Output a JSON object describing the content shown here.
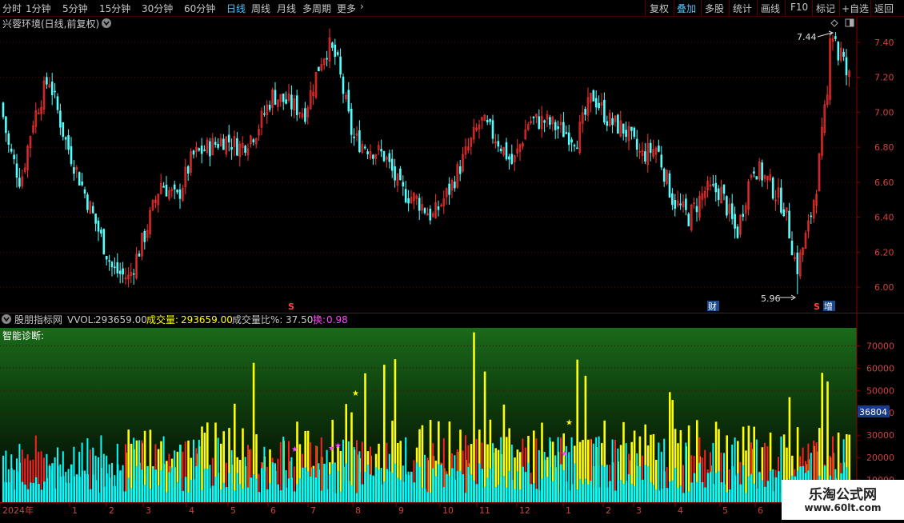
{
  "toolbar": {
    "periods": [
      "分时",
      "1分钟",
      "5分钟",
      "15分钟",
      "30分钟",
      "60分钟",
      "日线",
      "周线",
      "月线",
      "多周期",
      "更多"
    ],
    "active_period": "日线",
    "right_buttons": [
      "复权",
      "叠加",
      "多股",
      "统计",
      "画线",
      "F10",
      "标记",
      "+自选",
      "返回"
    ],
    "active_right": "叠加"
  },
  "main_chart": {
    "title": "兴蓉环境(日线,前复权)",
    "price_high_label": "7.44",
    "price_low_label": "5.96",
    "event_markers": [
      "财",
      "增"
    ],
    "s_markers": [
      "S",
      "S"
    ]
  },
  "indicator": {
    "name": "股朋指标网",
    "vol_label": "VVOL:",
    "vol_value": "293659.00",
    "cjl_label": "成交量:",
    "cjl_value": "293659.00",
    "ratio_label": "成交量比%:",
    "ratio_value": "37.50",
    "turnover_label": "换:",
    "turnover_value": "0.98",
    "diagnosis_label": "智能诊断:",
    "current_value_tag": "36804"
  },
  "time_axis": {
    "labels": [
      "2024年",
      "1",
      "2",
      "3",
      "4",
      "5",
      "6",
      "7",
      "8",
      "9",
      "10",
      "11",
      "12",
      "1",
      "2",
      "3",
      "4",
      "5",
      "6"
    ]
  },
  "watermark": {
    "line1": "乐淘公式网",
    "line2": "www.60lt.com"
  },
  "chart_data": [
    {
      "type": "candlestick",
      "title": "兴蓉环境(日线,前复权)",
      "y_ticks": [
        6.0,
        6.2,
        6.4,
        6.6,
        6.8,
        7.0,
        7.2,
        7.4
      ],
      "ylim": [
        5.9,
        7.5
      ],
      "high": 7.44,
      "low": 5.96,
      "close_path_anchors": [
        [
          0,
          7.05
        ],
        [
          10,
          6.8
        ],
        [
          25,
          6.6
        ],
        [
          40,
          6.95
        ],
        [
          60,
          7.2
        ],
        [
          80,
          6.85
        ],
        [
          100,
          6.6
        ],
        [
          120,
          6.35
        ],
        [
          140,
          6.1
        ],
        [
          160,
          6.05
        ],
        [
          180,
          6.3
        ],
        [
          200,
          6.6
        ],
        [
          220,
          6.5
        ],
        [
          240,
          6.75
        ],
        [
          260,
          6.8
        ],
        [
          280,
          6.85
        ],
        [
          300,
          6.8
        ],
        [
          320,
          6.9
        ],
        [
          340,
          7.1
        ],
        [
          360,
          7.05
        ],
        [
          380,
          7.0
        ],
        [
          400,
          7.3
        ],
        [
          410,
          7.38
        ],
        [
          420,
          7.3
        ],
        [
          440,
          6.85
        ],
        [
          460,
          6.8
        ],
        [
          480,
          6.75
        ],
        [
          500,
          6.55
        ],
        [
          520,
          6.5
        ],
        [
          540,
          6.4
        ],
        [
          560,
          6.55
        ],
        [
          580,
          6.75
        ],
        [
          600,
          6.95
        ],
        [
          620,
          6.85
        ],
        [
          640,
          6.7
        ],
        [
          660,
          6.95
        ],
        [
          680,
          6.95
        ],
        [
          700,
          6.9
        ],
        [
          720,
          6.85
        ],
        [
          740,
          7.1
        ],
        [
          760,
          6.95
        ],
        [
          780,
          6.9
        ],
        [
          800,
          6.75
        ],
        [
          820,
          6.8
        ],
        [
          840,
          6.5
        ],
        [
          860,
          6.4
        ],
        [
          880,
          6.55
        ],
        [
          900,
          6.55
        ],
        [
          920,
          6.3
        ],
        [
          940,
          6.7
        ],
        [
          960,
          6.6
        ],
        [
          980,
          6.45
        ],
        [
          995,
          6.1
        ],
        [
          1010,
          6.35
        ],
        [
          1020,
          6.6
        ],
        [
          1030,
          7.0
        ],
        [
          1040,
          7.25
        ],
        [
          1050,
          7.35
        ],
        [
          1058,
          7.2
        ]
      ]
    },
    {
      "type": "bar",
      "title": "股朋指标网",
      "y_ticks": [
        10000,
        20000,
        30000,
        40000,
        50000,
        60000,
        70000
      ],
      "ylim": [
        0,
        78000
      ],
      "series": [
        {
          "name": "成交量",
          "color": "#ffff00"
        },
        {
          "name": "VVOL",
          "color": "#00ffff"
        }
      ]
    }
  ]
}
